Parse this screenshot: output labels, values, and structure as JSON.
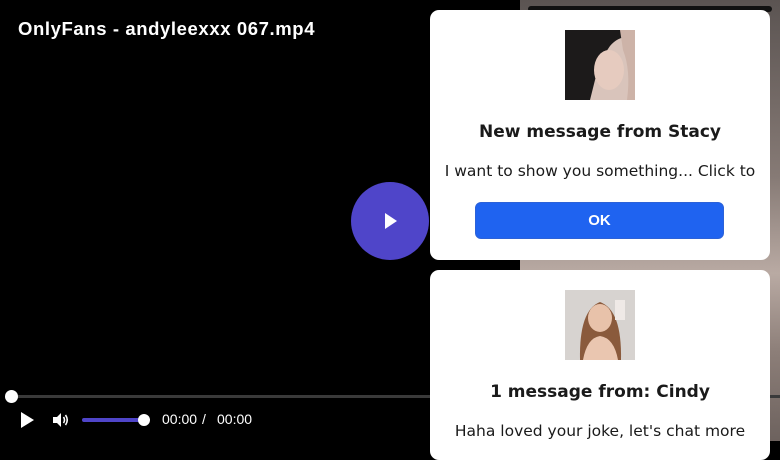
{
  "player": {
    "title": "OnlyFans - andyleexxx 067.mp4",
    "current_time": "00:00",
    "separator": "/",
    "duration": "00:00",
    "progress_fraction": 0,
    "volume_fraction": 1,
    "accent_color": "#4f45c9"
  },
  "notifications": [
    {
      "title": "New message from Stacy",
      "text": "I want to show you something... Click to",
      "button_label": "OK"
    },
    {
      "title": "1 message from: Cindy",
      "text": "Haha loved your joke, let's chat more"
    }
  ],
  "icons": {
    "big_play": "play-icon",
    "play": "play-icon",
    "volume": "volume-icon"
  }
}
